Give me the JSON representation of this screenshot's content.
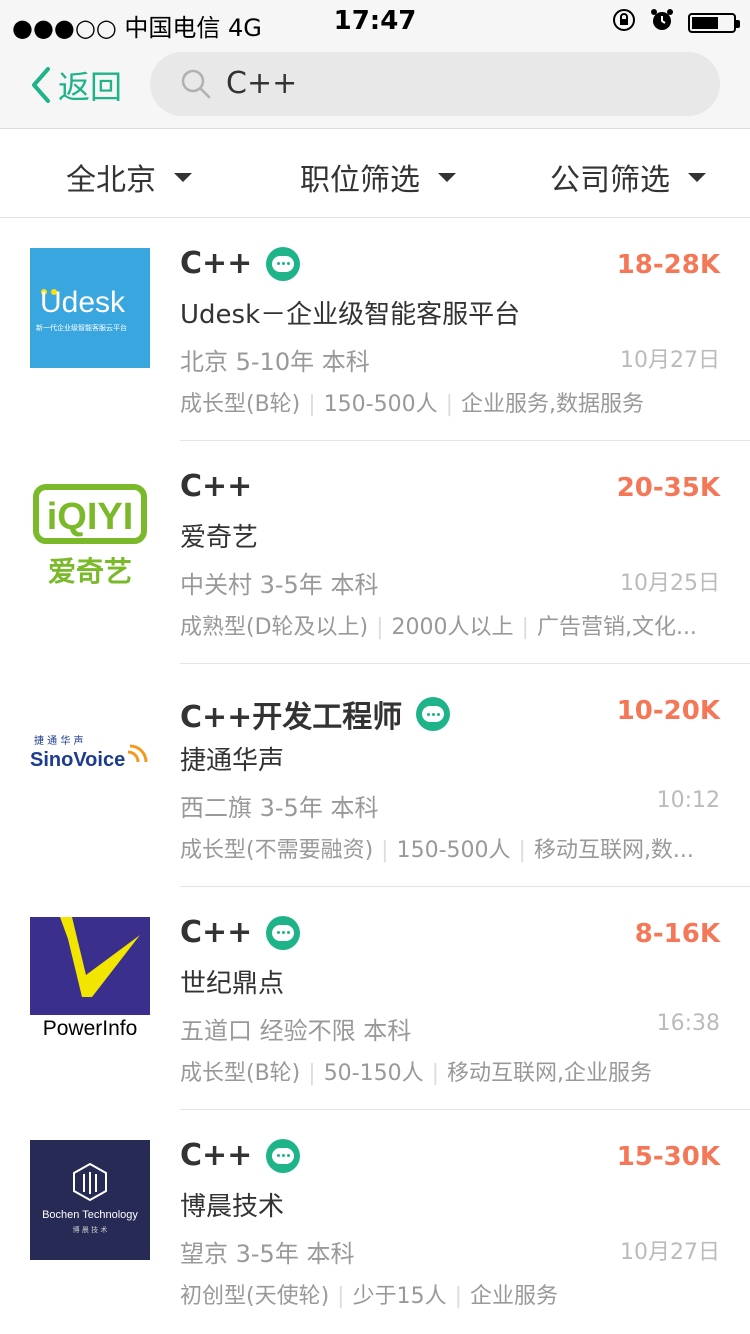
{
  "status": {
    "signal": "●●●○○ 中国电信 4G",
    "time": "17:47"
  },
  "nav": {
    "back_label": "返回",
    "search_query": "C++"
  },
  "filters": [
    {
      "label": "全北京"
    },
    {
      "label": "职位筛选"
    },
    {
      "label": "公司筛选"
    }
  ],
  "jobs": [
    {
      "title": "C++",
      "chat": true,
      "salary": "18-28K",
      "company": "Udesk－企业级智能客服平台",
      "meta": "北京 5-10年 本科",
      "date": "10月27日",
      "tags": [
        "成长型(B轮)",
        "150-500人",
        "企业服务,数据服务"
      ],
      "logo": {
        "name": "udesk-logo",
        "text": "Udesk",
        "sub": "新一代企业级智能客服云平台",
        "bg": "#3aa6e0"
      }
    },
    {
      "title": "C++",
      "chat": false,
      "salary": "20-35K",
      "company": "爱奇艺",
      "meta": "中关村 3-5年 本科",
      "date": "10月25日",
      "tags": [
        "成熟型(D轮及以上)",
        "2000人以上",
        "广告营销,文化..."
      ],
      "logo": {
        "name": "iqiyi-logo",
        "text": "iQIYI",
        "sub": "爱奇艺",
        "bg": "#ffffff",
        "fg": "#7ab929"
      }
    },
    {
      "title": "C++开发工程师",
      "chat": true,
      "salary": "10-20K",
      "company": "捷通华声",
      "meta": "西二旗 3-5年 本科",
      "date": "10:12",
      "tags": [
        "成长型(不需要融资)",
        "150-500人",
        "移动互联网,数..."
      ],
      "logo": {
        "name": "sinovoice-logo",
        "text": "SinoVoice",
        "sub": "捷 通 华 声",
        "bg": "#ffffff",
        "fg": "#1d3b8f"
      }
    },
    {
      "title": "C++",
      "chat": true,
      "salary": "8-16K",
      "company": "世纪鼎点",
      "meta": "五道口 经验不限 本科",
      "date": "16:38",
      "tags": [
        "成长型(B轮)",
        "50-150人",
        "移动互联网,企业服务"
      ],
      "logo": {
        "name": "powerinfo-logo",
        "text": "PowerInfo",
        "bg": "#3a2f8c",
        "fg": "#f2e500"
      }
    },
    {
      "title": "C++",
      "chat": true,
      "salary": "15-30K",
      "company": "博晨技术",
      "meta": "望京 3-5年 本科",
      "date": "10月27日",
      "tags": [
        "初创型(天使轮)",
        "少于15人",
        "企业服务"
      ],
      "logo": {
        "name": "bochen-logo",
        "text": "Bochen Technology",
        "sub": "博 晨 技 术",
        "bg": "#262a55"
      }
    }
  ]
}
